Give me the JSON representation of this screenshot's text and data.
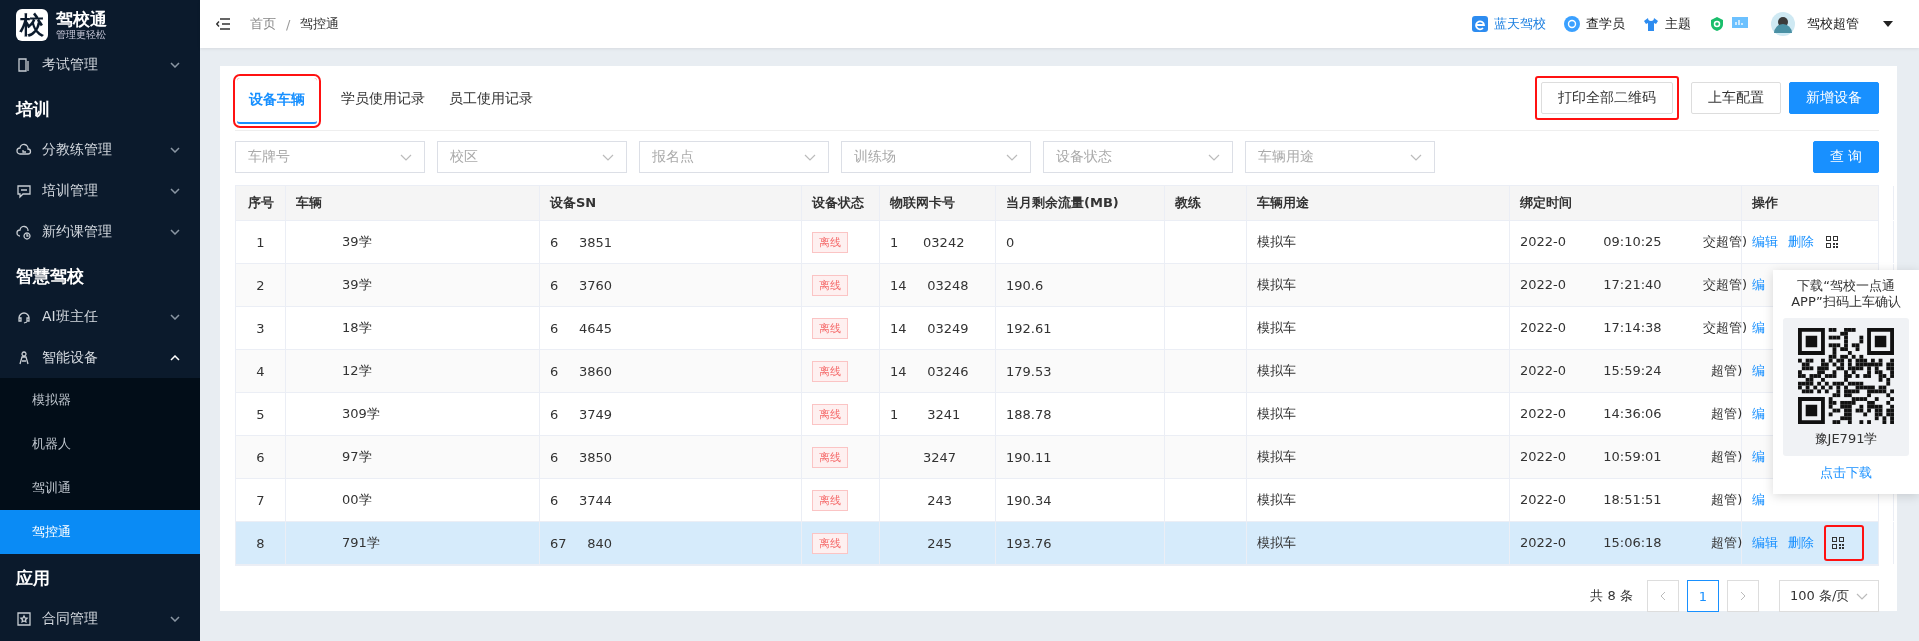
{
  "logo": {
    "mark": "校",
    "name": "驾校通",
    "slogan": "管理更轻松"
  },
  "sidebar": [
    {
      "kind": "item",
      "label": "考试管理",
      "expanded": false
    },
    {
      "kind": "group",
      "label": "培训"
    },
    {
      "kind": "item",
      "label": "分教练管理",
      "expanded": false
    },
    {
      "kind": "item",
      "label": "培训管理",
      "expanded": false
    },
    {
      "kind": "item",
      "label": "新约课管理",
      "expanded": false
    },
    {
      "kind": "group",
      "label": "智慧驾校"
    },
    {
      "kind": "item",
      "label": "AI班主任",
      "expanded": false
    },
    {
      "kind": "item",
      "label": "智能设备",
      "expanded": true
    },
    {
      "kind": "sub",
      "label": "模拟器",
      "selected": false
    },
    {
      "kind": "sub",
      "label": "机器人",
      "selected": false
    },
    {
      "kind": "sub",
      "label": "驾训通",
      "selected": false
    },
    {
      "kind": "sub",
      "label": "驾控通",
      "selected": true
    },
    {
      "kind": "group",
      "label": "应用"
    },
    {
      "kind": "item",
      "label": "合同管理",
      "expanded": false
    }
  ],
  "breadcrumb": [
    "首页",
    "驾控通"
  ],
  "breadcrumb_separator": "/",
  "header": {
    "school": "蓝天驾校",
    "search_student": "查学员",
    "theme": "主题",
    "user": "驾校超管"
  },
  "tabs": [
    {
      "label": "设备车辆",
      "selected": true,
      "annotated": true
    },
    {
      "label": "学员使用记录",
      "selected": false,
      "annotated": false
    },
    {
      "label": "员工使用记录",
      "selected": false,
      "annotated": false
    }
  ],
  "buttons": [
    {
      "label": "打印全部二维码",
      "kind": "plain",
      "annotated": true
    },
    {
      "label": "上车配置",
      "kind": "plain",
      "annotated": false
    },
    {
      "label": "新增设备",
      "kind": "primary",
      "annotated": false
    }
  ],
  "filters": [
    {
      "placeholder": "车牌号"
    },
    {
      "placeholder": "校区"
    },
    {
      "placeholder": "报名点"
    },
    {
      "placeholder": "训练场"
    },
    {
      "placeholder": "设备状态"
    },
    {
      "placeholder": "车辆用途"
    }
  ],
  "query_button": "查 询",
  "table": {
    "columns": [
      "序号",
      "车辆",
      "设备SN",
      "设备状态",
      "物联网卡号",
      "当月剩余流量(MB)",
      "教练",
      "车辆用途",
      "绑定时间",
      "操作"
    ],
    "rows": [
      {
        "no": "1",
        "vehicle": "39学",
        "sn": "6     3851",
        "status": "离线",
        "card": "1      03242",
        "flow": "0",
        "use": "模拟车",
        "time": "2022-0         09:10:25          交超管)",
        "actions": [
          "编辑",
          "删除"
        ],
        "qr": true,
        "selected": false,
        "annotated": false
      },
      {
        "no": "2",
        "vehicle": "39学",
        "sn": "6     3760",
        "status": "离线",
        "card": "14     03248",
        "flow": "190.6",
        "use": "模拟车",
        "time": "2022-0         17:21:40          交超管)",
        "actions": [
          "编"
        ],
        "selected": false
      },
      {
        "no": "3",
        "vehicle": "18学",
        "sn": "6     4645",
        "status": "离线",
        "card": "14     03249",
        "flow": "192.61",
        "use": "模拟车",
        "time": "2022-0         17:14:38          交超管)",
        "actions": [
          "编"
        ],
        "selected": false
      },
      {
        "no": "4",
        "vehicle": "12学",
        "sn": "6     3860",
        "status": "离线",
        "card": "14     03246",
        "flow": "179.53",
        "use": "模拟车",
        "time": "2022-0         15:59:24            超管)",
        "actions": [
          "编"
        ],
        "selected": false
      },
      {
        "no": "5",
        "vehicle": "309学",
        "sn": "6     3749",
        "status": "离线",
        "card": "1       3241",
        "flow": "188.78",
        "use": "模拟车",
        "time": "2022-0         14:36:06            超管)",
        "actions": [
          "编"
        ],
        "selected": false
      },
      {
        "no": "6",
        "vehicle": "97学",
        "sn": "6     3850",
        "status": "离线",
        "card": "        3247",
        "flow": "190.11",
        "use": "模拟车",
        "time": "2022-0         10:59:01            超管)",
        "actions": [
          "编"
        ],
        "selected": false
      },
      {
        "no": "7",
        "vehicle": "00学",
        "sn": "6     3744",
        "status": "离线",
        "card": "         243",
        "flow": "190.34",
        "use": "模拟车",
        "time": "2022-0         18:51:51            超管)",
        "actions": [
          "编"
        ],
        "selected": false
      },
      {
        "no": "8",
        "vehicle": "791学",
        "sn": "67     840",
        "status": "离线",
        "card": "         245",
        "flow": "193.76",
        "use": "模拟车",
        "time": "2022-0         15:06:18            超管)",
        "actions": [
          "编辑",
          "删除"
        ],
        "qr": true,
        "selected": true,
        "annotated": true
      }
    ]
  },
  "popover": {
    "text": "下载“驾校一点通APP”扫码上车确认",
    "plate": "豫JE791学",
    "link": "点击下载"
  },
  "pagination": {
    "total": "共 8 条",
    "pages": [
      {
        "label": "1",
        "selected": true
      }
    ],
    "page_size": "100 条/页"
  }
}
